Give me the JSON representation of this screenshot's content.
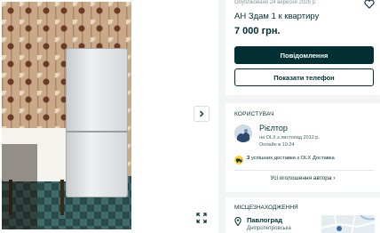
{
  "ad": {
    "published": "Опубліковано 24 вересня 2026 р.",
    "title": "АН Здам 1 к квартиру",
    "price": "7 000 грн."
  },
  "actions": {
    "message_label": "Повідомлення",
    "phone_label": "Показати телефон"
  },
  "seller": {
    "section_label": "КОРИСТУВАЧ",
    "name": "Рієлтор",
    "since": "на OLX з листопад 2012 р.",
    "online": "Онлайн в 10:24",
    "delivery_count": "3",
    "delivery_text": " успішних доставки з OLX Доставка",
    "all_ads_label": "Усі оголошення автора"
  },
  "location": {
    "section_label": "МІСЦЕЗНАХОДЖЕННЯ",
    "city": "Павлоград",
    "region": "Дніпропетровська"
  },
  "colors": {
    "brand_dark": "#002f34",
    "background": "#f2f4f5",
    "delivery_badge": "#ffce32"
  },
  "icons": {
    "gallery_next": "chevron-right-icon",
    "gallery_fullscreen": "expand-icon",
    "favorite": "heart-icon",
    "delivery": "delivery-icon",
    "location": "pin-icon"
  }
}
